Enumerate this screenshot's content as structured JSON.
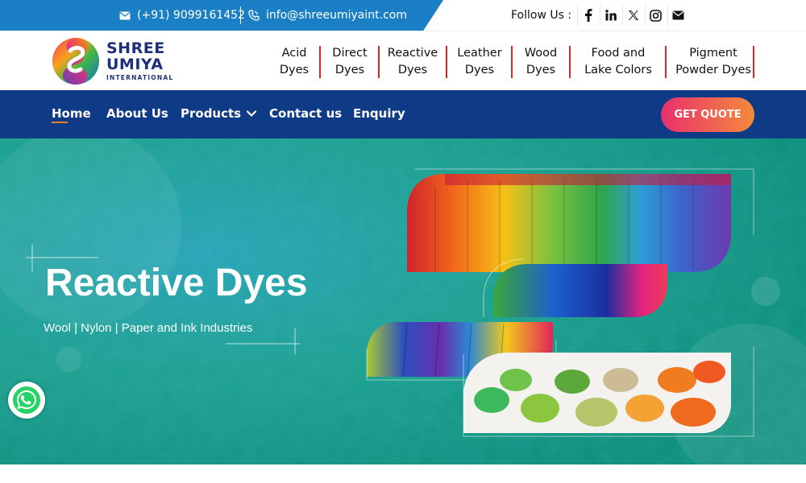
{
  "topbar": {
    "phone": "(+91) 9099161452",
    "email": "info@shreeumiyaint.com",
    "follow_label": "Follow Us :",
    "social": [
      "facebook-icon",
      "linkedin-icon",
      "x-icon",
      "instagram-icon",
      "mail-icon"
    ]
  },
  "logo": {
    "line1": "SHREE",
    "line2": "UMIYA",
    "line3": "INTERNATIONAL"
  },
  "categories": [
    {
      "l1": "Acid",
      "l2": "Dyes"
    },
    {
      "l1": "Direct",
      "l2": "Dyes"
    },
    {
      "l1": "Reactive",
      "l2": "Dyes"
    },
    {
      "l1": "Leather",
      "l2": "Dyes"
    },
    {
      "l1": "Wood",
      "l2": "Dyes"
    },
    {
      "l1": "Food and",
      "l2": "Lake Colors"
    },
    {
      "l1": "Pigment",
      "l2": "Powder Dyes"
    }
  ],
  "nav": {
    "home": "Home",
    "about": "About Us",
    "products": "Products",
    "contact": "Contact us",
    "enquiry": "Enquiry",
    "cta": "GET QUOTE"
  },
  "hero": {
    "title": "Reactive Dyes",
    "subtitle": "Wool | Nylon | Paper and Ink Industries"
  },
  "colors": {
    "topbar_blue": "#1a7fc4",
    "nav_blue": "#0f3b86",
    "accent_red": "#e02424",
    "cta_start": "#e8306e",
    "cta_end": "#f48a3a",
    "hero_teal": "#1aa28a"
  }
}
